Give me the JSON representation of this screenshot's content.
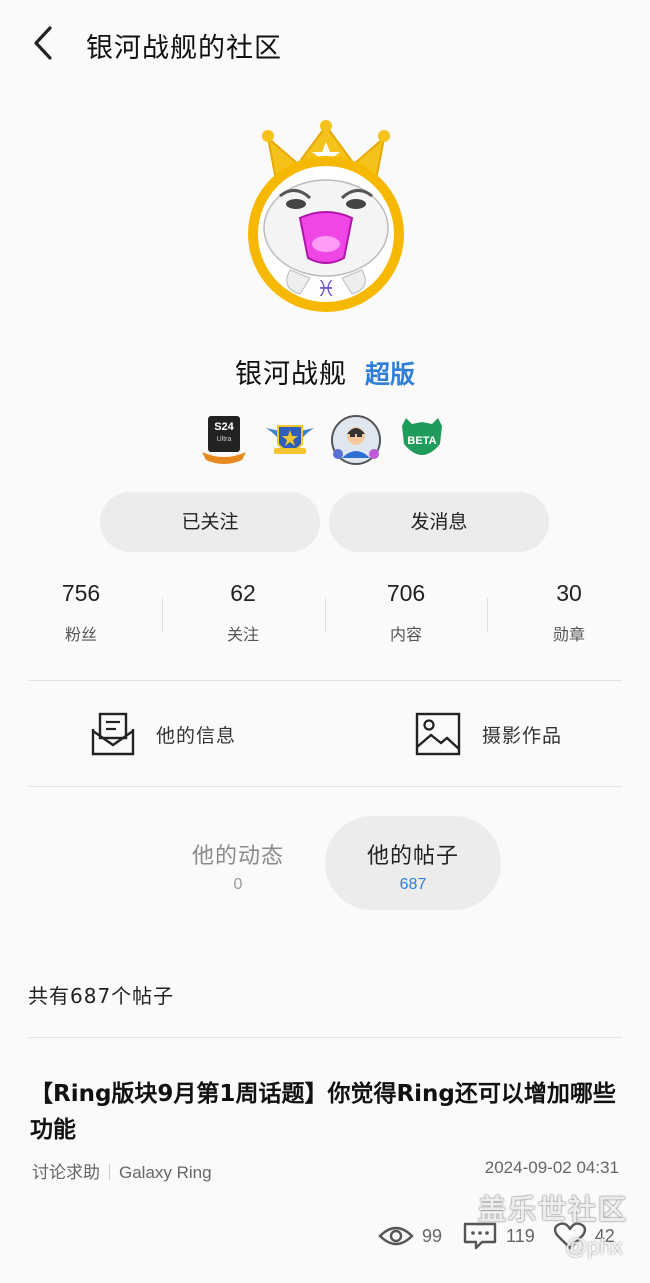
{
  "header": {
    "title": "银河战舰的社区"
  },
  "profile": {
    "name": "银河战舰",
    "badge": "超版"
  },
  "medals": [
    {
      "icon": "s24-ultra-medal-icon",
      "text": "S24 Ultra"
    },
    {
      "icon": "winged-shield-medal-icon"
    },
    {
      "icon": "avatar-medal-icon"
    },
    {
      "icon": "beta-shield-medal-icon",
      "text": "BETA"
    }
  ],
  "actions": {
    "follow_label": "已关注",
    "message_label": "发消息"
  },
  "stats": [
    {
      "value": "756",
      "label": "粉丝"
    },
    {
      "value": "62",
      "label": "关注"
    },
    {
      "value": "706",
      "label": "内容"
    },
    {
      "value": "30",
      "label": "勋章"
    }
  ],
  "info_links": {
    "info_label": "他的信息",
    "photo_label": "摄影作品"
  },
  "tabs": [
    {
      "label": "他的动态",
      "count": "0"
    },
    {
      "label": "他的帖子",
      "count": "687"
    }
  ],
  "post_count_text": "共有687个帖子",
  "post": {
    "title": "【Ring版块9月第1周话题】你觉得Ring还可以增加哪些功能",
    "category": "讨论求助",
    "board": "Galaxy Ring",
    "date": "2024-09-02 04:31",
    "views": "99",
    "comments": "119",
    "likes": "42"
  },
  "watermark": {
    "line1": "盖乐世社区",
    "line2": "@phx"
  },
  "colors": {
    "badge": "#2f7fd8",
    "tab_active_count": "#2f7fd8",
    "button_bg": "#ececec"
  }
}
